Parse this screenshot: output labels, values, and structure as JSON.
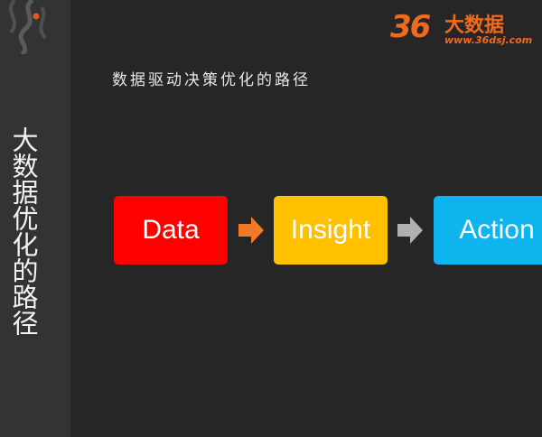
{
  "sidebar": {
    "title": "大数据优化的路径"
  },
  "slide": {
    "subtitle": "数据驱动决策优化的路径"
  },
  "brand": {
    "number": "36",
    "name": "大数据",
    "url": "www.36dsj.com",
    "color": "#f06a1e"
  },
  "flow": {
    "steps": [
      {
        "label": "Data",
        "color": "#ff0000"
      },
      {
        "label": "Insight",
        "color": "#ffc000"
      },
      {
        "label": "Action",
        "color": "#0fb4ef"
      }
    ],
    "arrows": [
      {
        "icon": "arrow-right-icon",
        "color": "#f07a28"
      },
      {
        "icon": "arrow-right-icon",
        "color": "#b0b0b0"
      }
    ]
  }
}
